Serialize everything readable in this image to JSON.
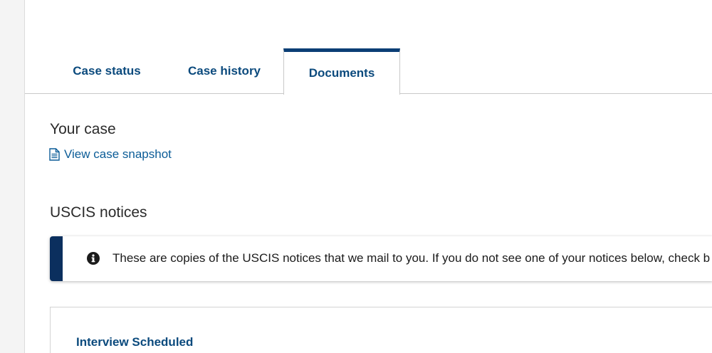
{
  "tabs": [
    {
      "label": "Case status",
      "active": false
    },
    {
      "label": "Case history",
      "active": false
    },
    {
      "label": "Documents",
      "active": true
    }
  ],
  "your_case": {
    "title": "Your case",
    "snapshot_link": "View case snapshot",
    "snapshot_icon": "document-icon"
  },
  "notices": {
    "title": "USCIS notices",
    "alert_icon": "info-icon",
    "alert_text": "These are copies of the USCIS notices that we mail to you. If you do not see one of your notices below, check b",
    "cards": [
      {
        "title": "Interview Scheduled"
      }
    ]
  },
  "colors": {
    "accent": "#0b3e75",
    "link": "#0b5c97",
    "tab_text": "#0b4a7d"
  }
}
